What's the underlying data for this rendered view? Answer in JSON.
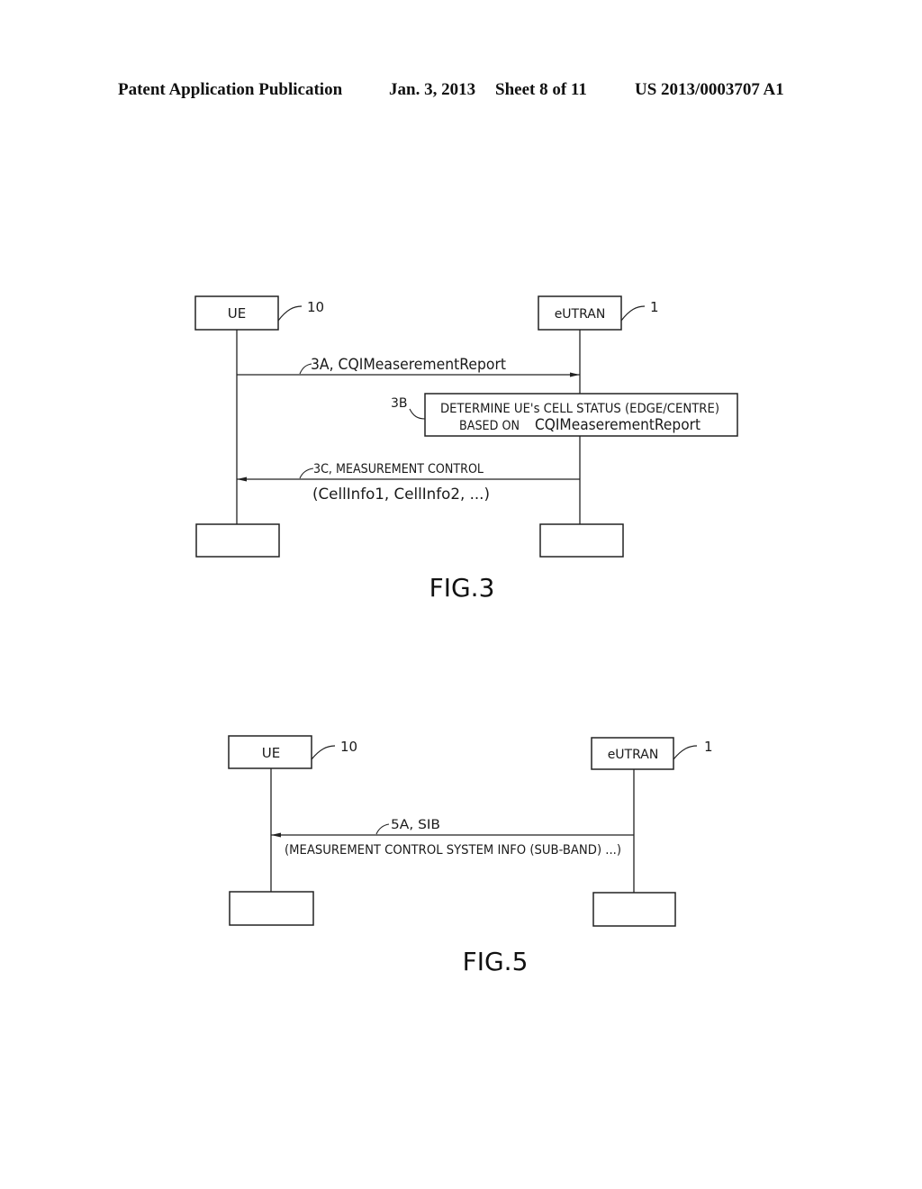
{
  "header": {
    "publication": "Patent Application Publication",
    "date": "Jan. 3, 2013",
    "sheet": "Sheet 8 of 11",
    "number": "US 2013/0003707 A1"
  },
  "fig3": {
    "caption": "FIG.3",
    "entities": [
      {
        "label": "UE",
        "ref": "10"
      },
      {
        "label": "eUTRAN",
        "ref": "1"
      }
    ],
    "messages": [
      {
        "id": "3A",
        "label": "3A,  CQIMeaserementReport",
        "from": "UE",
        "to": "eUTRAN"
      },
      {
        "id": "3C",
        "label": "3C, MEASUREMENT CONTROL",
        "sublabel": "(CellInfo1,  CellInfo2,  ...)",
        "from": "eUTRAN",
        "to": "UE"
      }
    ],
    "process": {
      "ref": "3B",
      "line1": "DETERMINE UE's CELL STATUS (EDGE/CENTRE)",
      "line2_prefix": "BASED ON",
      "line2_value": "CQIMeaserementReport"
    }
  },
  "fig5": {
    "caption": "FIG.5",
    "entities": [
      {
        "label": "UE",
        "ref": "10"
      },
      {
        "label": "eUTRAN",
        "ref": "1"
      }
    ],
    "messages": [
      {
        "id": "5A",
        "label": "5A, SIB",
        "sublabel": "(MEASUREMENT CONTROL SYSTEM INFO (SUB-BAND) ...)",
        "from": "eUTRAN",
        "to": "UE"
      }
    ]
  }
}
